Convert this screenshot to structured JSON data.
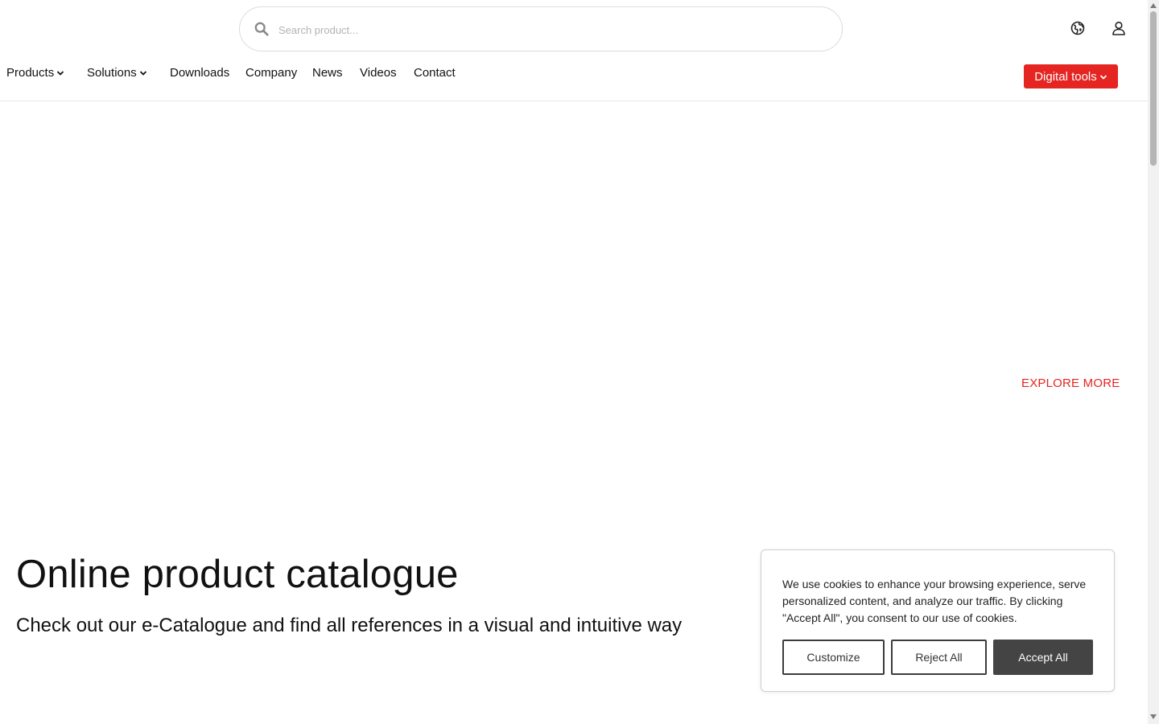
{
  "header": {
    "search": {
      "placeholder": "Search product...",
      "value": ""
    },
    "icons": {
      "language": "globe-icon",
      "account": "user-icon"
    }
  },
  "nav": {
    "items": [
      {
        "label": "Products",
        "has_dropdown": true
      },
      {
        "label": "Solutions",
        "has_dropdown": true
      },
      {
        "label": "Downloads",
        "has_dropdown": false
      },
      {
        "label": "Company",
        "has_dropdown": false
      },
      {
        "label": "News",
        "has_dropdown": false
      },
      {
        "label": "Videos",
        "has_dropdown": false
      },
      {
        "label": "Contact",
        "has_dropdown": false
      }
    ],
    "digital_tools_label": "Digital tools"
  },
  "hero": {
    "explore_label": "EXPLORE MORE"
  },
  "catalogue": {
    "title": "Online product catalogue",
    "subtitle": "Check out our e-Catalogue and find all references in a visual and intuitive way"
  },
  "cookie_banner": {
    "text": "We use cookies to enhance your browsing experience, serve personalized content, and analyze our traffic. By clicking \"Accept All\", you consent to our use of cookies.",
    "customize_label": "Customize",
    "reject_label": "Reject All",
    "accept_label": "Accept All"
  },
  "colors": {
    "brand_red": "#e52521",
    "accept_button": "#444444",
    "text": "#111111"
  }
}
